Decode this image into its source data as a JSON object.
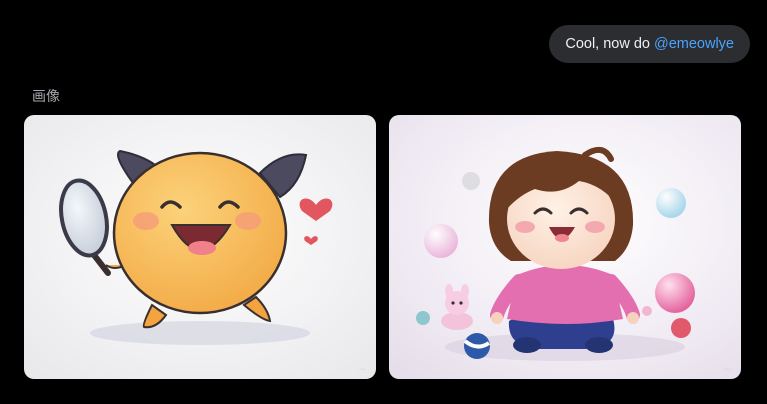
{
  "message": {
    "text": "Cool, now do",
    "mention": "@emeowlye"
  },
  "gallery": {
    "label": "画像",
    "images": [
      {
        "subject": "smiling-yellow-creature-with-magnifying-glass"
      },
      {
        "subject": "smiling-girl-with-bubbles-and-toys"
      }
    ]
  },
  "colors": {
    "background": "#000000",
    "bubble": "#2b2d31",
    "mention": "#4aa3ff",
    "label": "#a3a6ab"
  }
}
